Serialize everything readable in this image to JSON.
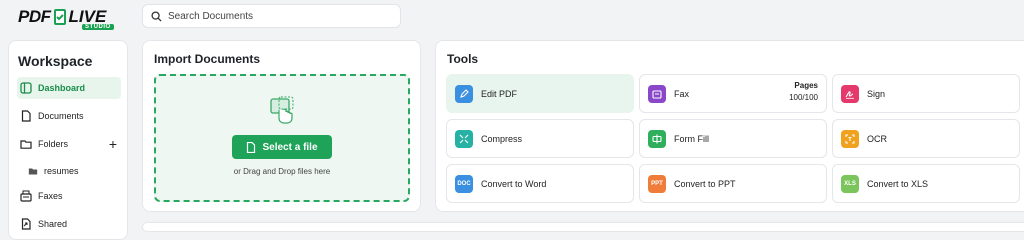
{
  "brand": {
    "logo_pdf": "PDF",
    "logo_live": "LIVE",
    "logo_studio": "STUDIO"
  },
  "search": {
    "placeholder": "Search Documents",
    "value": ""
  },
  "sidebar": {
    "title": "Workspace",
    "items": [
      {
        "label": "Dashboard",
        "icon": "dashboard-icon",
        "active": true
      },
      {
        "label": "Documents",
        "icon": "document-icon"
      },
      {
        "label": "Folders",
        "icon": "folder-icon",
        "action": "+"
      },
      {
        "label": "resumes",
        "icon": "folder-filled-icon",
        "sub": true
      },
      {
        "label": "Faxes",
        "icon": "fax-icon"
      },
      {
        "label": "Shared",
        "icon": "shared-icon"
      }
    ]
  },
  "import": {
    "title": "Import Documents",
    "button": "Select a file",
    "hint": "or Drag and Drop files here"
  },
  "tools": {
    "title": "Tools",
    "items": [
      {
        "label": "Edit PDF",
        "icon": "edit-pdf-icon",
        "color": "#3b8fe0"
      },
      {
        "label": "Fax",
        "icon": "fax-icon",
        "color": "#8a47c9",
        "pages_label": "Pages",
        "pages_value": "100/100"
      },
      {
        "label": "Sign",
        "icon": "sign-icon",
        "color": "#e5396b"
      },
      {
        "label": "Compress",
        "icon": "compress-icon",
        "color": "#25b2a4"
      },
      {
        "label": "Form Fill",
        "icon": "form-fill-icon",
        "color": "#2fae5c"
      },
      {
        "label": "OCR",
        "icon": "ocr-icon",
        "color": "#f0a11e"
      },
      {
        "label": "Convert to Word",
        "icon": "word-icon",
        "color": "#3b8fe0",
        "badge": "DOC"
      },
      {
        "label": "Convert to PPT",
        "icon": "ppt-icon",
        "color": "#f07c3a",
        "badge": "PPT"
      },
      {
        "label": "Convert to XLS",
        "icon": "xls-icon",
        "color": "#7cc45c",
        "badge": "XLS"
      }
    ]
  },
  "colors": {
    "accent": "#1ea359",
    "active_bg": "#e7f5ec"
  }
}
